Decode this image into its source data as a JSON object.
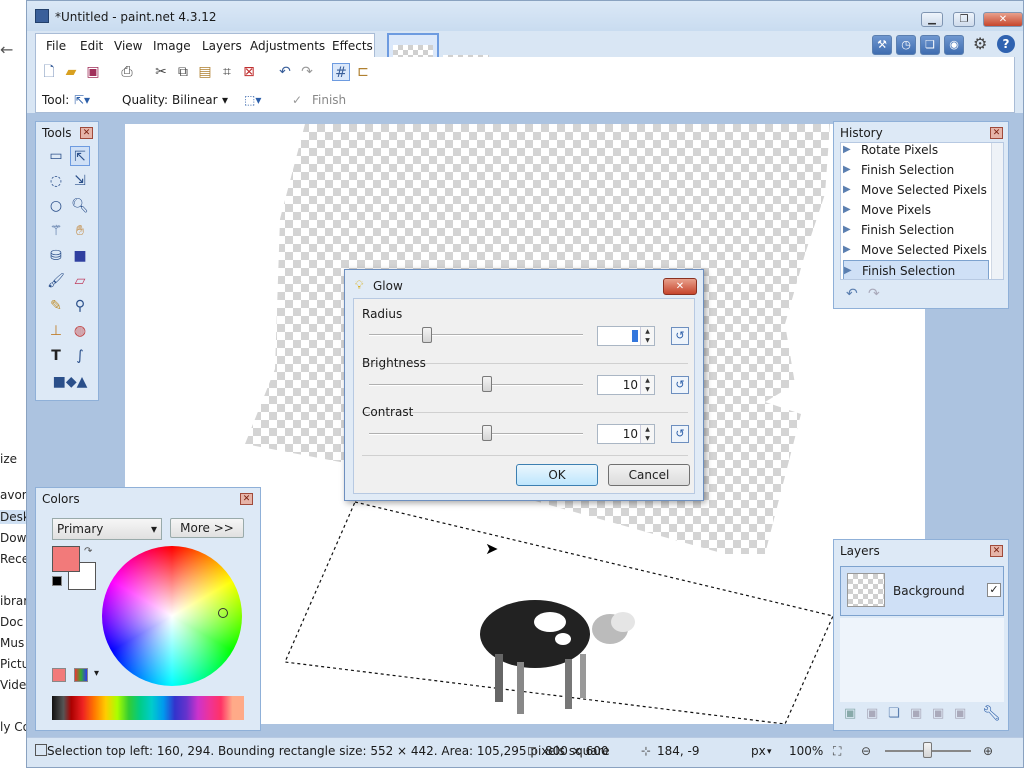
{
  "window": {
    "title": "*Untitled - paint.net 4.3.12"
  },
  "menu": [
    "File",
    "Edit",
    "View",
    "Image",
    "Layers",
    "Adjustments",
    "Effects"
  ],
  "toolbar2": {
    "tool_label": "Tool:",
    "quality_label": "Quality:",
    "quality_value": "Bilinear",
    "finish_label": "Finish"
  },
  "tools_panel": {
    "title": "Tools"
  },
  "history_panel": {
    "title": "History",
    "items": [
      "Rotate Pixels",
      "Finish Selection",
      "Move Selected Pixels",
      "Move Pixels",
      "Finish Selection",
      "Move Selected Pixels",
      "Finish Selection"
    ]
  },
  "colors_panel": {
    "title": "Colors",
    "mode": "Primary",
    "more_label": "More >>",
    "primary_color": "#f27a7a",
    "secondary_color": "#ffffff"
  },
  "layers_panel": {
    "title": "Layers",
    "layer_name": "Background"
  },
  "dialog": {
    "title": "Glow",
    "radius_label": "Radius",
    "radius_value": "",
    "brightness_label": "Brightness",
    "brightness_value": "10",
    "contrast_label": "Contrast",
    "contrast_value": "10",
    "ok_label": "OK",
    "cancel_label": "Cancel"
  },
  "status": {
    "selection": "Selection top left: 160, 294. Bounding rectangle size: 552 × 442. Area: 105,295 pixels square",
    "image_size": "800 × 600",
    "cursor": "184, -9",
    "units": "px",
    "zoom": "100%"
  },
  "background_window": [
    "avori",
    "Desk",
    "Dow",
    "Rece",
    "ibrari",
    "Doc",
    "Mus",
    "Pictu",
    "Vide",
    "ly Co",
    "ize"
  ]
}
